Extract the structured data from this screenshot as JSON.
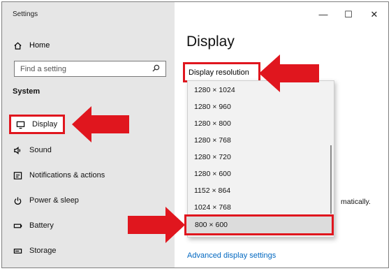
{
  "window": {
    "title": "Settings",
    "controls": {
      "minimize": "—",
      "maximize": "☐",
      "close": "✕"
    }
  },
  "sidebar": {
    "home_label": "Home",
    "search_placeholder": "Find a setting",
    "section": "System",
    "items": [
      {
        "label": "Display",
        "icon": "monitor-icon",
        "selected": true
      },
      {
        "label": "Sound",
        "icon": "speaker-icon"
      },
      {
        "label": "Notifications & actions",
        "icon": "notification-icon"
      },
      {
        "label": "Power & sleep",
        "icon": "power-icon"
      },
      {
        "label": "Battery",
        "icon": "battery-icon"
      },
      {
        "label": "Storage",
        "icon": "storage-icon"
      }
    ]
  },
  "main": {
    "page_title": "Display",
    "section_heading": "Display resolution",
    "partial_text": "matically.",
    "advanced_link": "Advanced display settings"
  },
  "resolution_dropdown": {
    "options": [
      "1280 × 1024",
      "1280 × 960",
      "1280 × 800",
      "1280 × 768",
      "1280 × 720",
      "1280 × 600",
      "1152 × 864",
      "1024 × 768",
      "800 × 600"
    ],
    "selected": "800 × 600"
  },
  "colors": {
    "highlight_red": "#e0161e",
    "sidebar_bg": "#e6e6e6",
    "link_blue": "#0067c0"
  }
}
